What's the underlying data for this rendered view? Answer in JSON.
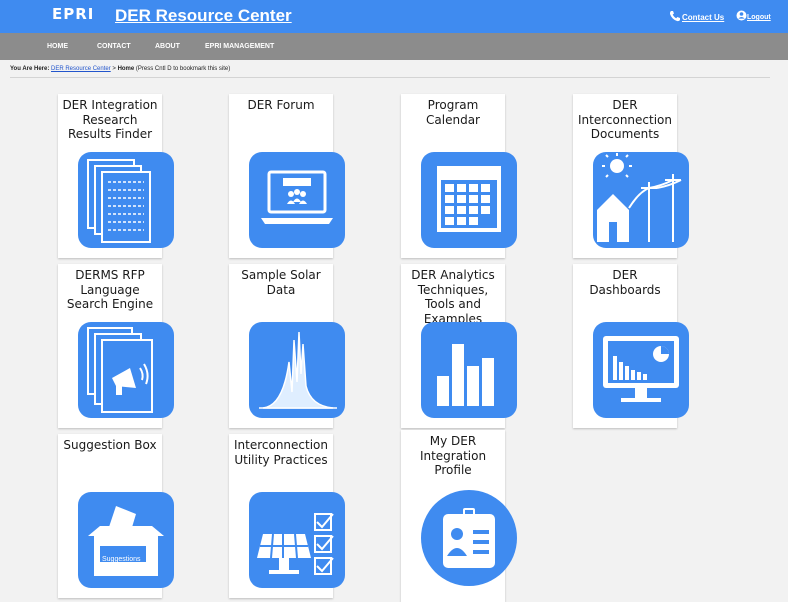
{
  "header": {
    "logo": "EPRI",
    "title": "DER Resource Center",
    "contact_label": "Contact Us",
    "logout_label": "Logout",
    "brand_color": "#3f8bf0"
  },
  "nav": {
    "items": [
      {
        "label": "HOME"
      },
      {
        "label": "CONTACT"
      },
      {
        "label": "ABOUT"
      },
      {
        "label": "EPRI MANAGEMENT"
      }
    ]
  },
  "breadcrumb": {
    "prefix": "You Are Here:",
    "link": "DER Resource Center",
    "separator": " > ",
    "current": "Home",
    "hint": " (Press Cntl D to bookmark this site)"
  },
  "tiles": [
    {
      "title": "DER Integration Research Results Finder",
      "icon": "documents-icon"
    },
    {
      "title": "DER Forum",
      "icon": "laptop-meeting-icon"
    },
    {
      "title": "Program Calendar",
      "icon": "calendar-icon"
    },
    {
      "title": "DER Interconnection Documents",
      "icon": "house-powerline-icon"
    },
    {
      "title": "DERMS RFP Language Search Engine",
      "icon": "megaphone-documents-icon"
    },
    {
      "title": "Sample Solar Data",
      "icon": "solar-curve-icon"
    },
    {
      "title": "DER Analytics Techniques, Tools and Examples",
      "icon": "bar-chart-icon"
    },
    {
      "title": "DER Dashboards",
      "icon": "monitor-dashboard-icon"
    },
    {
      "title": "Suggestion Box",
      "icon": "ballot-box-icon",
      "icon_text": "Suggestions"
    },
    {
      "title": "Interconnection Utility Practices",
      "icon": "solar-panel-checklist-icon"
    },
    {
      "title": "My DER Integration Profile",
      "icon": "profile-badge-icon"
    }
  ]
}
